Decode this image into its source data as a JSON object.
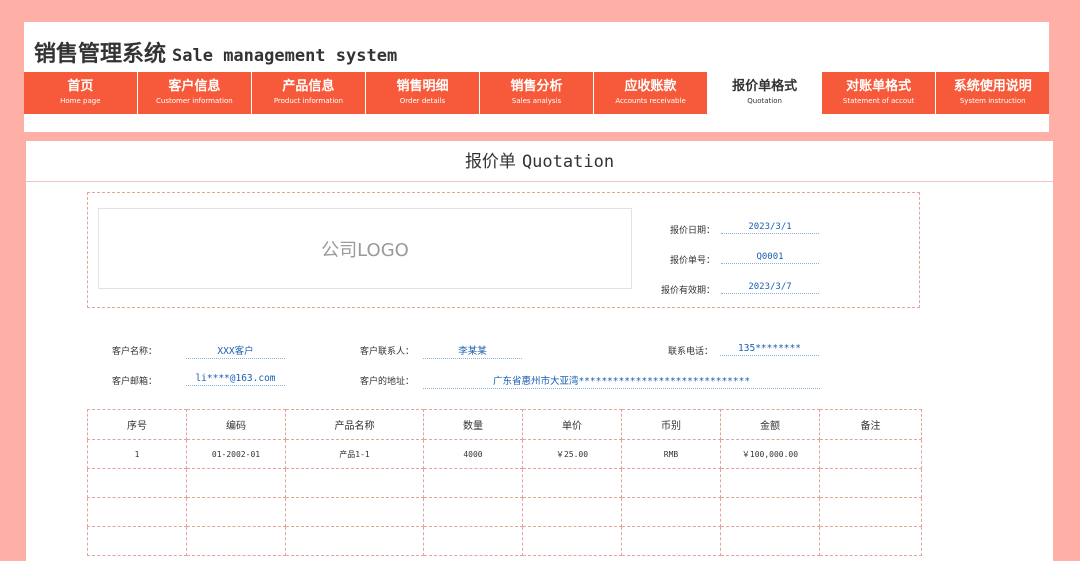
{
  "app": {
    "title_zh": "销售管理系统",
    "title_en": "Sale management system"
  },
  "nav": [
    {
      "zh": "首页",
      "en": "Home page"
    },
    {
      "zh": "客户信息",
      "en": "Customer information"
    },
    {
      "zh": "产品信息",
      "en": "Product information"
    },
    {
      "zh": "销售明细",
      "en": "Order details"
    },
    {
      "zh": "销售分析",
      "en": "Sales analysis"
    },
    {
      "zh": "应收账款",
      "en": "Accounts receivable"
    },
    {
      "zh": "报价单格式",
      "en": "Quotation"
    },
    {
      "zh": "对账单格式",
      "en": "Statement of accout"
    },
    {
      "zh": "系统使用说明",
      "en": "System instruction"
    }
  ],
  "active_tab": "报价单格式",
  "doc": {
    "title_zh": "报价单",
    "title_en": "Quotation",
    "logo_text": "公司LOGO"
  },
  "quote_meta": {
    "date_label": "报价日期：",
    "date_value": "2023/3/1",
    "number_label": "报价单号：",
    "number_value": "Q0001",
    "valid_label": "报价有效期：",
    "valid_value": "2023/3/7"
  },
  "customer": {
    "name_label": "客户名称：",
    "name_value": "XXX客户",
    "contact_label": "客户联系人：",
    "contact_value": "李某某",
    "phone_label": "联系电话：",
    "phone_value": "135********",
    "email_label": "客户邮箱：",
    "email_value": "li****@163.com",
    "address_label": "客户的地址：",
    "address_value": "广东省惠州市大亚湾******************************"
  },
  "table": {
    "headers": [
      "序号",
      "编码",
      "产品名称",
      "数量",
      "单价",
      "币别",
      "金额",
      "备注"
    ],
    "rows": [
      [
        "1",
        "01-2002-01",
        "产品1-1",
        "4000",
        "￥25.00",
        "RMB",
        "￥100,000.00",
        ""
      ],
      [
        "",
        "",
        "",
        "",
        "",
        "",
        "",
        ""
      ],
      [
        "",
        "",
        "",
        "",
        "",
        "",
        "",
        ""
      ],
      [
        "",
        "",
        "",
        "",
        "",
        "",
        "",
        ""
      ]
    ]
  }
}
